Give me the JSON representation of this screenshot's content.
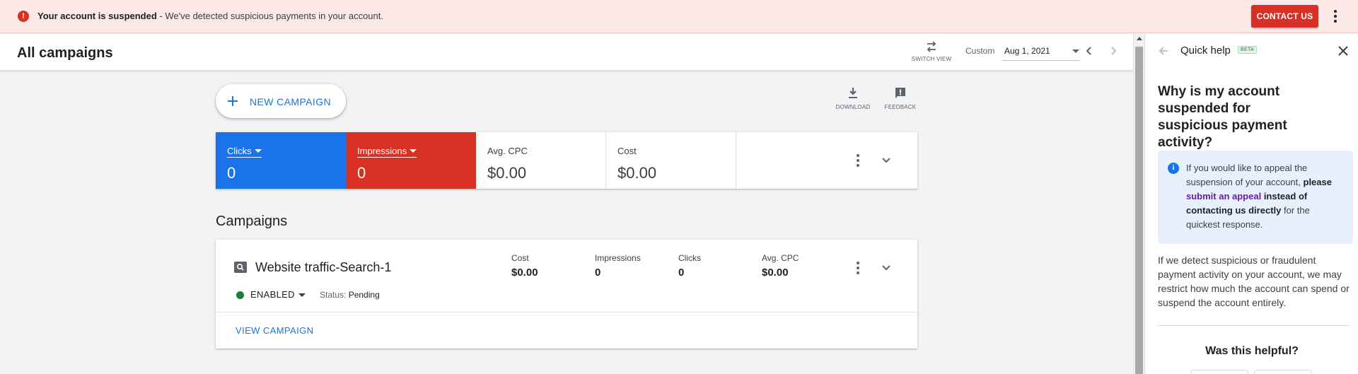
{
  "alert": {
    "bold_text": "Your account is suspended",
    "text": " - We've detected suspicious payments in your account.",
    "contact_label": "CONTACT US"
  },
  "header": {
    "title": "All campaigns",
    "switch_view_label": "SWITCH VIEW",
    "date_range_type": "Custom",
    "date_value": "Aug 1, 2021"
  },
  "toolbar": {
    "new_campaign_label": "NEW CAMPAIGN",
    "download_label": "DOWNLOAD",
    "feedback_label": "FEEDBACK"
  },
  "scorecard": {
    "metrics": [
      {
        "label": "Clicks",
        "value": "0",
        "color": "#1a73e8"
      },
      {
        "label": "Impressions",
        "value": "0",
        "color": "#d93025"
      },
      {
        "label": "Avg. CPC",
        "value": "$0.00"
      },
      {
        "label": "Cost",
        "value": "$0.00"
      }
    ]
  },
  "campaigns": {
    "section_title": "Campaigns",
    "items": [
      {
        "name": "Website traffic-Search-1",
        "stats": [
          {
            "label": "Cost",
            "value": "$0.00"
          },
          {
            "label": "Impressions",
            "value": "0"
          },
          {
            "label": "Clicks",
            "value": "0"
          },
          {
            "label": "Avg. CPC",
            "value": "$0.00"
          }
        ],
        "state": "ENABLED",
        "status_label": "Status:",
        "status_value": "Pending",
        "view_label": "VIEW CAMPAIGN"
      }
    ]
  },
  "quick_help": {
    "title": "Quick help",
    "badge": "BETA",
    "question": "Why is my account suspended for suspicious payment activity?",
    "info": {
      "part1": "If you would like to appeal the suspension of your account, ",
      "part2": "please ",
      "link": "submit an appeal",
      "part3": " instead of contacting us directly",
      "part4": " for the quickest response."
    },
    "body": "If we detect suspicious or fraudulent payment activity on your account, we may restrict how much the account can spend or suspend the account entirely.",
    "helpful_label": "Was this helpful?"
  },
  "icons": {
    "alert": "error-icon",
    "switch_view": "swap-icon",
    "download": "download-icon",
    "feedback": "feedback-icon",
    "campaign_type": "search-icon"
  },
  "colors": {
    "accent": "#1a73e8",
    "danger": "#d93025",
    "enabled": "#188038",
    "alert_bg": "#fce8e6"
  }
}
